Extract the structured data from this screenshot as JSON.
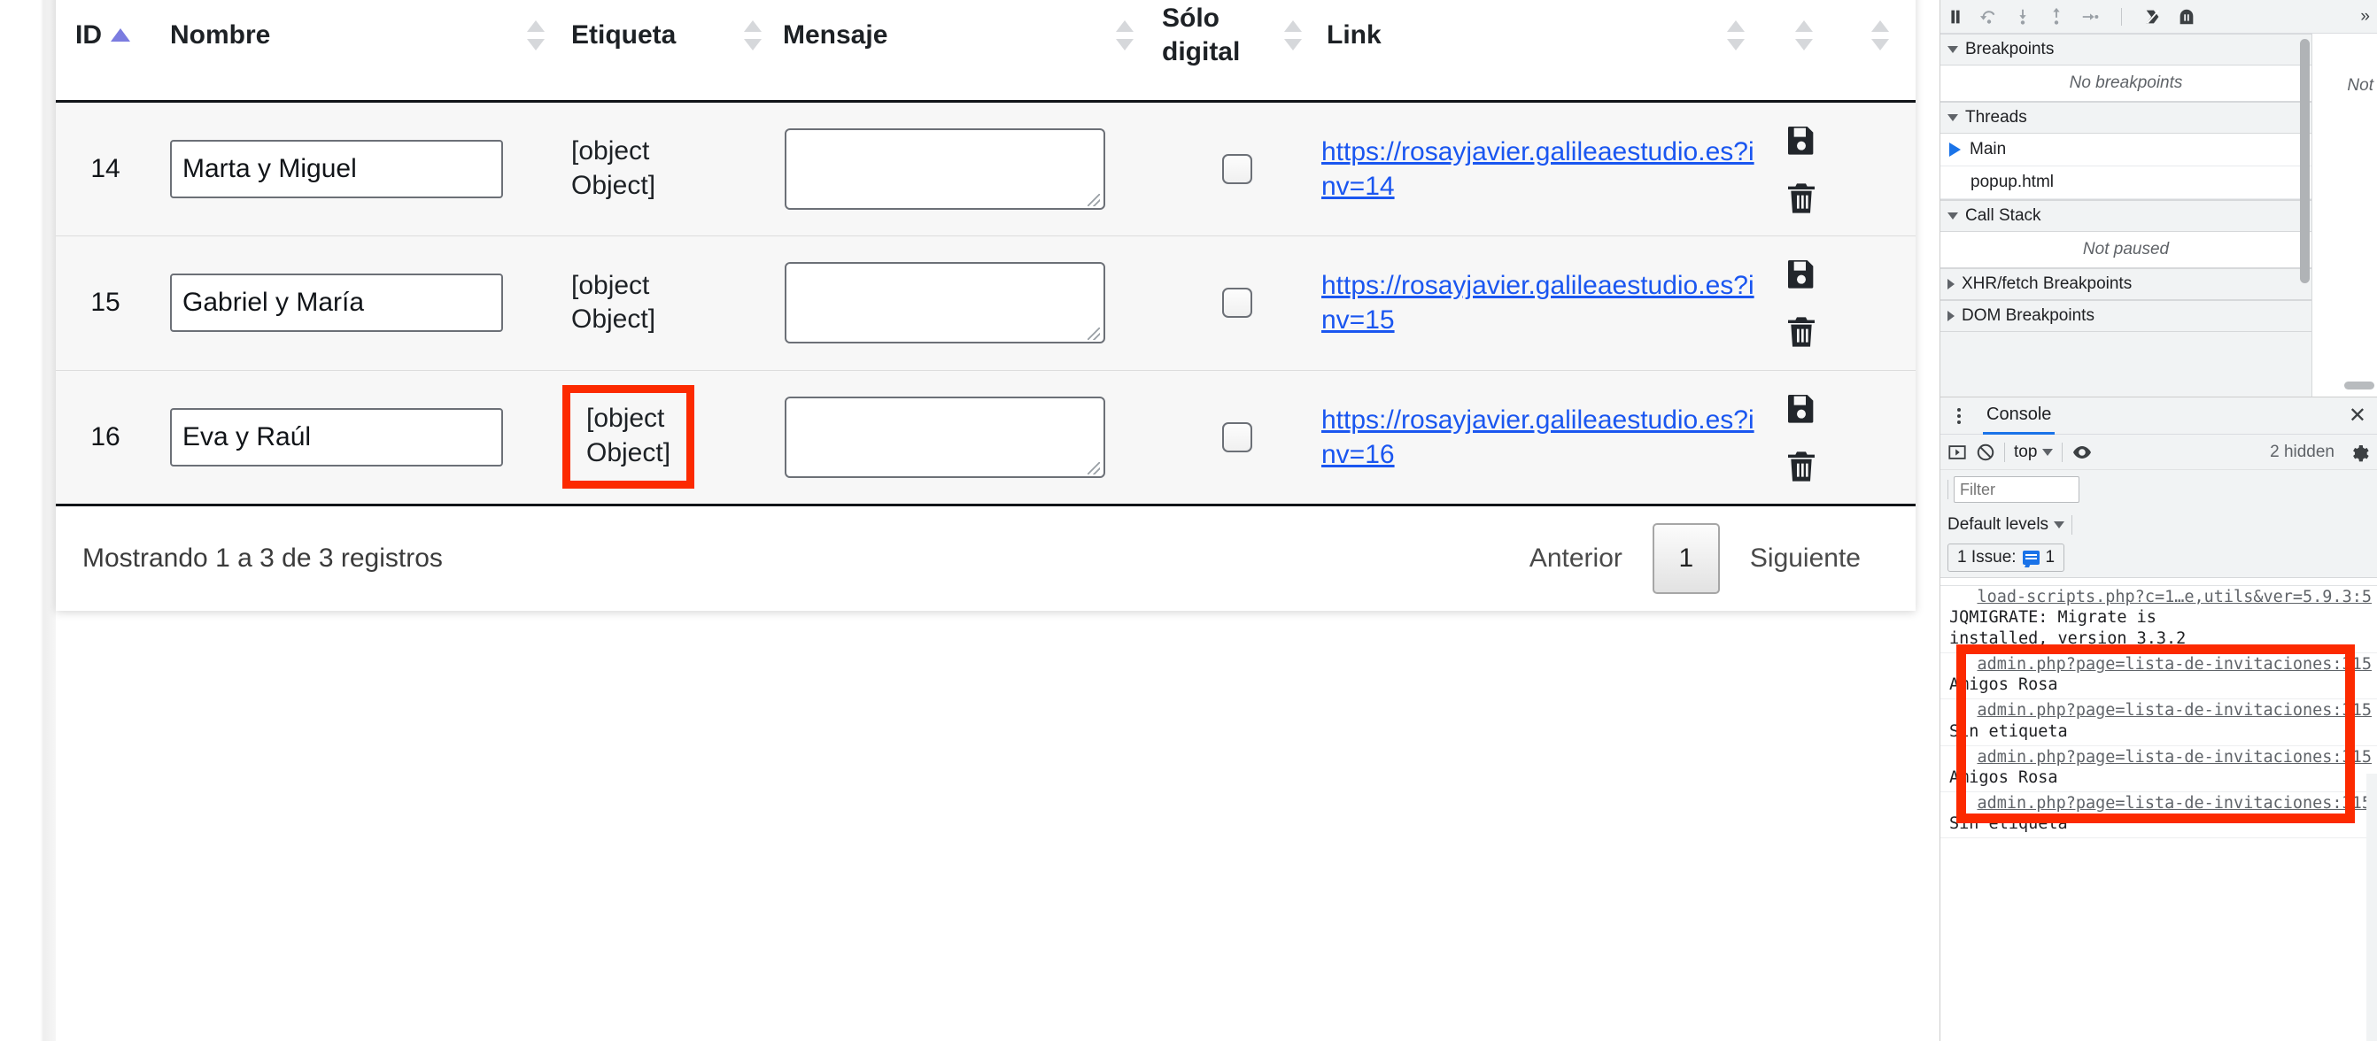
{
  "table": {
    "columns": [
      {
        "label": "ID",
        "sort": "asc"
      },
      {
        "label": "Nombre",
        "sort": "both"
      },
      {
        "label": "Etiqueta",
        "sort": "both"
      },
      {
        "label": "Mensaje",
        "sort": "both"
      },
      {
        "label": "Sólo\ndigital",
        "sort": "both"
      },
      {
        "label": "Link",
        "sort": "both"
      },
      {
        "label": "",
        "sort": "both"
      },
      {
        "label": "",
        "sort": "both"
      }
    ],
    "rows": [
      {
        "id": "14",
        "nombre": "Marta y Miguel",
        "etiqueta": "[object\nObject]",
        "mensaje": "",
        "solo_digital_checked": false,
        "link": "https://rosayjavier.galileaestudio.es?inv=14",
        "highlight_etiqueta": false
      },
      {
        "id": "15",
        "nombre": "Gabriel y María",
        "etiqueta": "[object\nObject]",
        "mensaje": "",
        "solo_digital_checked": false,
        "link": "https://rosayjavier.galileaestudio.es?inv=15",
        "highlight_etiqueta": false
      },
      {
        "id": "16",
        "nombre": "Eva y Raúl",
        "etiqueta": "[object\nObject]",
        "mensaje": "",
        "solo_digital_checked": false,
        "link": "https://rosayjavier.galileaestudio.es?inv=16",
        "highlight_etiqueta": true
      }
    ],
    "footer": {
      "info": "Mostrando 1 a 3 de 3 registros",
      "previous": "Anterior",
      "page": "1",
      "next": "Siguiente"
    },
    "icons": {
      "save": "save-floppy-icon",
      "delete": "trash-icon"
    }
  },
  "devtools": {
    "debugger_toolbar": {
      "icons": [
        "pause-icon",
        "step-over-icon",
        "step-into-icon",
        "step-out-icon",
        "step-icon",
        "deactivate-breakpoints-icon",
        "pause-on-exceptions-icon"
      ],
      "more_tabs": "»"
    },
    "sections": [
      {
        "title": "Breakpoints",
        "expanded": true,
        "empty_text": "No breakpoints"
      },
      {
        "title": "Threads",
        "expanded": true
      },
      {
        "title": "Call Stack",
        "expanded": true,
        "empty_text": "Not paused"
      },
      {
        "title": "XHR/fetch Breakpoints",
        "expanded": false
      },
      {
        "title": "DOM Breakpoints",
        "expanded": false
      }
    ],
    "threads": [
      {
        "label": "Main",
        "active": true
      },
      {
        "label": "popup.html",
        "active": false
      }
    ],
    "right_pane_text": "Not",
    "console": {
      "tab_label": "Console",
      "close_label": "✕",
      "context": "top",
      "hidden_text": "2 hidden",
      "filter_placeholder": "Filter",
      "levels_label": "Default levels",
      "issue_label": "1 Issue:",
      "issue_count": "1",
      "icons": {
        "sidebar": "console-sidebar-icon",
        "clear": "clear-console-icon",
        "eye": "eye-icon",
        "settings": "gear-icon",
        "kebab": "more-options-icon"
      },
      "messages": [
        {
          "source": "load-scripts.php?c=1…e,utils&ver=5.9.3:5",
          "text": "JQMIGRATE: Migrate is\ninstalled, version 3.3.2"
        },
        {
          "source": "admin.php?page=lista-de-invitaciones:315",
          "text": "Amigos Rosa"
        },
        {
          "source": "admin.php?page=lista-de-invitaciones:315",
          "text": "Sin etiqueta"
        },
        {
          "source": "admin.php?page=lista-de-invitaciones:315",
          "text": "Amigos Rosa"
        },
        {
          "source": "admin.php?page=lista-de-invitaciones:315",
          "text": "Sin etiqueta"
        }
      ]
    }
  },
  "colors": {
    "highlight": "#fc2a00",
    "link": "#1a56f0",
    "accent": "#1a73e8",
    "sort_active": "#7b7ce0"
  }
}
